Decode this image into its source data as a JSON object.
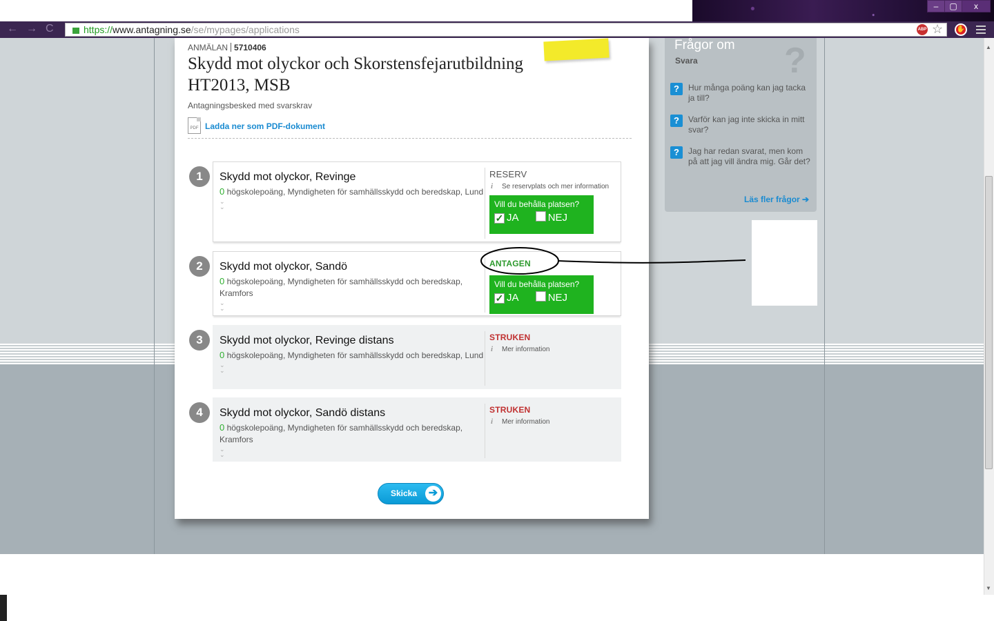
{
  "browser": {
    "url_protocol": "https://",
    "url_host": "www.antagning.se",
    "url_path": "/se/mypages/applications",
    "nav_back": "←",
    "nav_forward": "→",
    "nav_reload": "C",
    "ext_abp": "ABP",
    "window_minimize": "–",
    "window_maximize": "▢",
    "window_close": "x"
  },
  "application": {
    "label": "ANMÄLAN",
    "number": "5710406",
    "title": "Skydd mot olyckor och Skorstensfejarutbildning HT2013, MSB",
    "subtitle": "Antagningsbesked med svarskrav",
    "pdf_icon_text": "PDF",
    "pdf_link": "Ladda ner som PDF-dokument"
  },
  "choices": [
    {
      "number": "1",
      "title": "Skydd mot olyckor, Revinge",
      "points": "0",
      "description": " högskolepoäng, Myndigheten för samhällsskydd och beredskap, Lund",
      "status": "RESERV",
      "info": "Se reservplats och mer information",
      "keep_question": "Vill du behålla platsen?",
      "yes_label": "JA",
      "no_label": "NEJ"
    },
    {
      "number": "2",
      "title": "Skydd mot olyckor, Sandö",
      "points": "0",
      "description": " högskolepoäng, Myndigheten för samhällsskydd och beredskap, Kramfors",
      "status": "ANTAGEN",
      "keep_question": "Vill du behålla platsen?",
      "yes_label": "JA",
      "no_label": "NEJ"
    },
    {
      "number": "3",
      "title": "Skydd mot olyckor, Revinge distans",
      "points": "0",
      "description": " högskolepoäng, Myndigheten för samhällsskydd och beredskap, Lund",
      "status": "STRUKEN",
      "info": "Mer information"
    },
    {
      "number": "4",
      "title": "Skydd mot olyckor, Sandö distans",
      "points": "0",
      "description": " högskolepoäng, Myndigheten för samhällsskydd och beredskap, Kramfors",
      "status": "STRUKEN",
      "info": "Mer information"
    }
  ],
  "send_button": "Skicka",
  "faq": {
    "title": "Frågor om",
    "subtitle": "Svara",
    "questions": [
      "Hur många poäng kan jag tacka ja till?",
      "Varför kan jag inte skicka in mitt svar?",
      "Jag har redan svarat, men kom på att jag vill ändra mig. Går det?"
    ],
    "more_link": "Läs fler frågor"
  },
  "colors": {
    "accent_blue": "#1a8bd1",
    "green": "#1fb31f",
    "admitted": "#2d9a2d",
    "struck": "#c03030"
  }
}
